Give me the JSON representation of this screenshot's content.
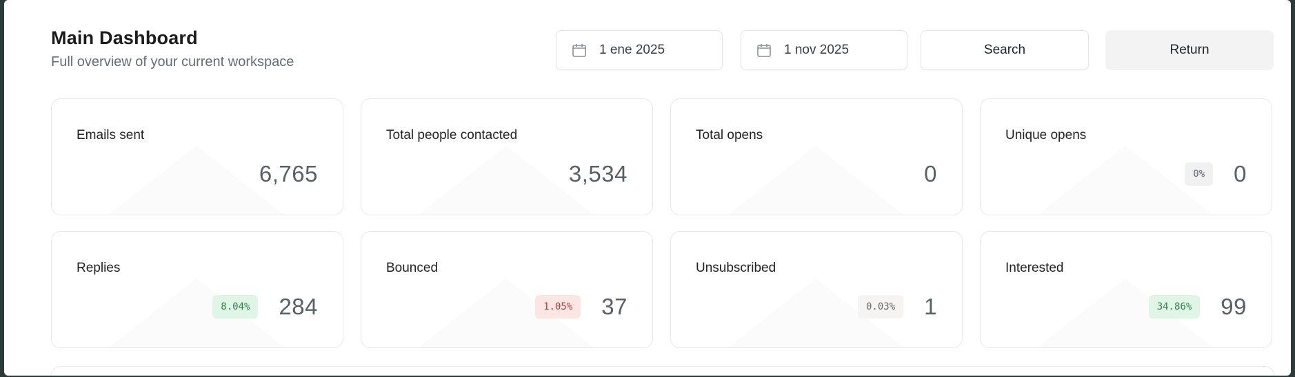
{
  "header": {
    "title": "Main Dashboard",
    "subtitle": "Full overview of your current workspace"
  },
  "filters": {
    "start_date": "1 ene 2025",
    "end_date": "1 nov 2025",
    "search_label": "Search",
    "return_label": "Return"
  },
  "stats": [
    {
      "label": "Emails sent",
      "value": "6,765",
      "badge": ""
    },
    {
      "label": "Total people contacted",
      "value": "3,534",
      "badge": ""
    },
    {
      "label": "Total opens",
      "value": "0",
      "badge": ""
    },
    {
      "label": "Unique opens",
      "value": "0",
      "badge": "0%"
    },
    {
      "label": "Replies",
      "value": "284",
      "badge": "8.04%"
    },
    {
      "label": "Bounced",
      "value": "37",
      "badge": "1.05%"
    },
    {
      "label": "Unsubscribed",
      "value": "1",
      "badge": "0.03%"
    },
    {
      "label": "Interested",
      "value": "99",
      "badge": "34.86%"
    }
  ],
  "colors": {
    "badge_positive_bg": "#dff5e6",
    "badge_negative_bg": "#fbe6e4",
    "badge_neutral_bg": "#f1f1f2"
  },
  "icons": {
    "date": "calendar-icon"
  }
}
